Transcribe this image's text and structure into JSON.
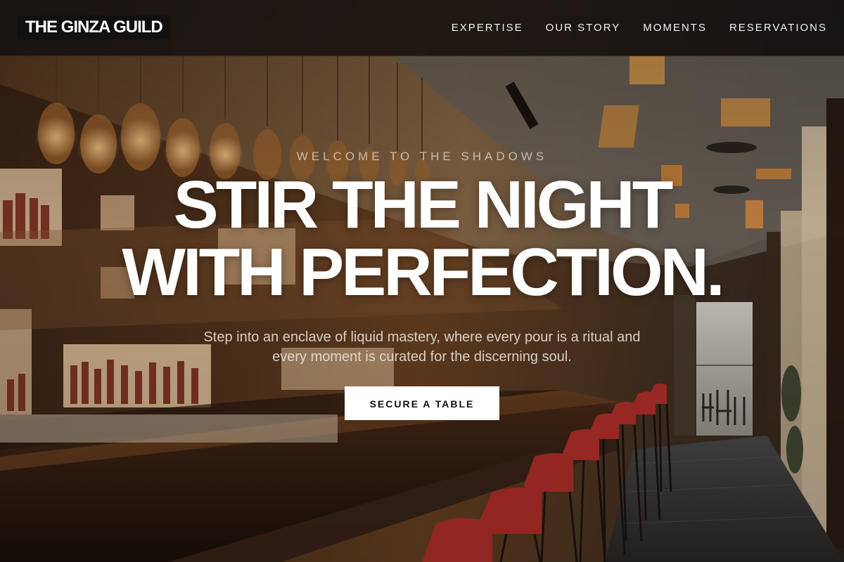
{
  "brand": {
    "logo_text": "THE GINZA GUILD"
  },
  "nav": {
    "items": [
      {
        "label": "EXPERTISE"
      },
      {
        "label": "OUR STORY"
      },
      {
        "label": "MOMENTS"
      },
      {
        "label": "RESERVATIONS"
      }
    ]
  },
  "hero": {
    "eyebrow": "WELCOME TO THE SHADOWS",
    "headline_line1": "STIR THE NIGHT",
    "headline_line2": "WITH PERFECTION.",
    "subtext": "Step into an enclave of liquid mastery, where every pour is a ritual and every moment is curated for the discerning soul.",
    "cta_label": "SECURE A TABLE",
    "background_image": "bar-interior-photo"
  },
  "colors": {
    "nav_background": "#141212",
    "cta_background": "#ffffff",
    "cta_text": "#111111",
    "accent_stool_red": "#b8302a",
    "ambient_amber": "#c8823c"
  }
}
